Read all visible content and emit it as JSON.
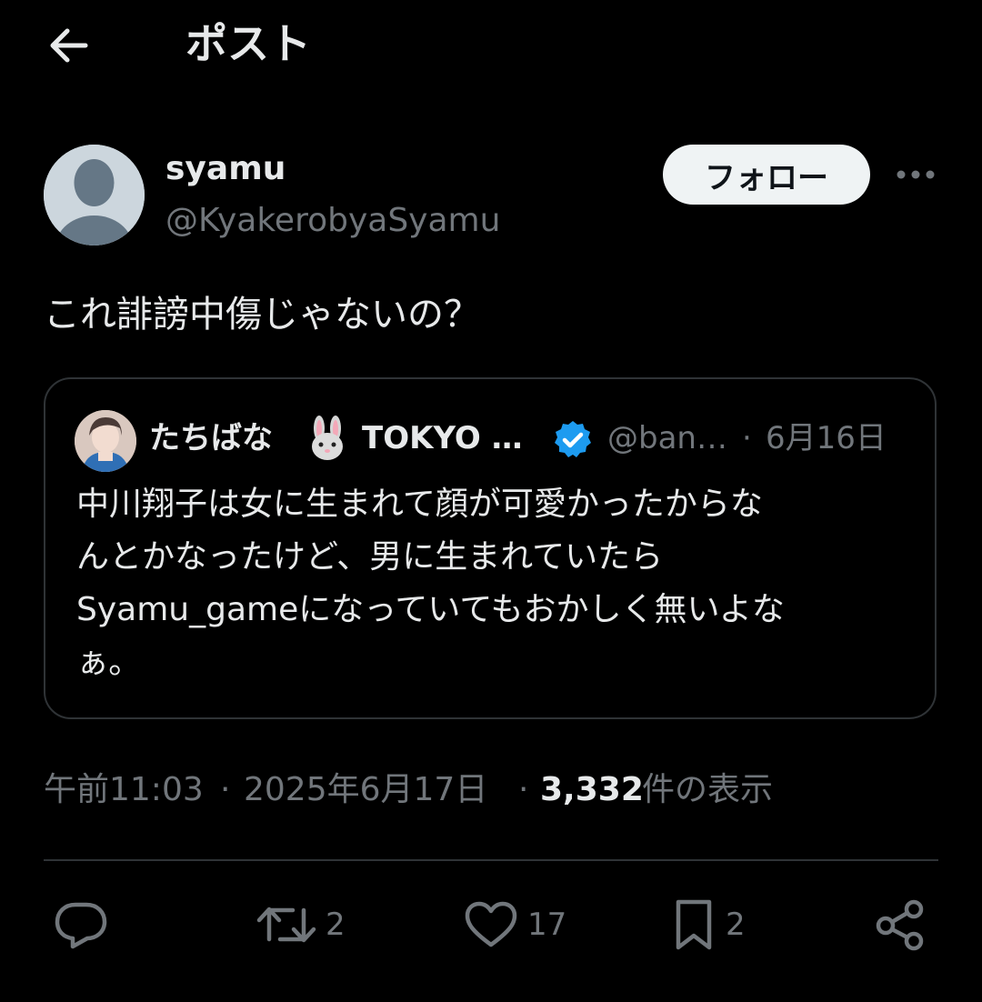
{
  "header": {
    "title": "ポスト",
    "back_icon": "arrow-left-icon"
  },
  "post": {
    "author_name": "syamu",
    "author_handle": "@KyakerobyaSyamu",
    "follow_label": "フォロー",
    "text": "これ誹謗中傷じゃないの？",
    "quoted": {
      "name": "たちばな",
      "name_suffix": "TOKYO …",
      "handle": "@ban…",
      "separator": "·",
      "date": "6月16日",
      "lines": [
        "中川翔子は女に生まれて顔が可愛かったからな",
        "んとかなったけど、男に生まれていたら",
        "Syamu_gameになっていてもおかしく無いよな",
        "ぁ。"
      ]
    },
    "meta": {
      "time": "午前11:03",
      "separator": "·",
      "date": "2025年6月17日",
      "views": "3,332",
      "views_label": "件の表示"
    },
    "actions": {
      "reply_count": "",
      "repost_count": "2",
      "like_count": "17",
      "bookmark_count": "2"
    }
  },
  "colors": {
    "background": "#000000",
    "text_primary": "#e7e9ea",
    "text_secondary": "#71767b",
    "border": "#2f3336",
    "follow_bg": "#eff3f4",
    "verified": "#1d9bf0"
  }
}
